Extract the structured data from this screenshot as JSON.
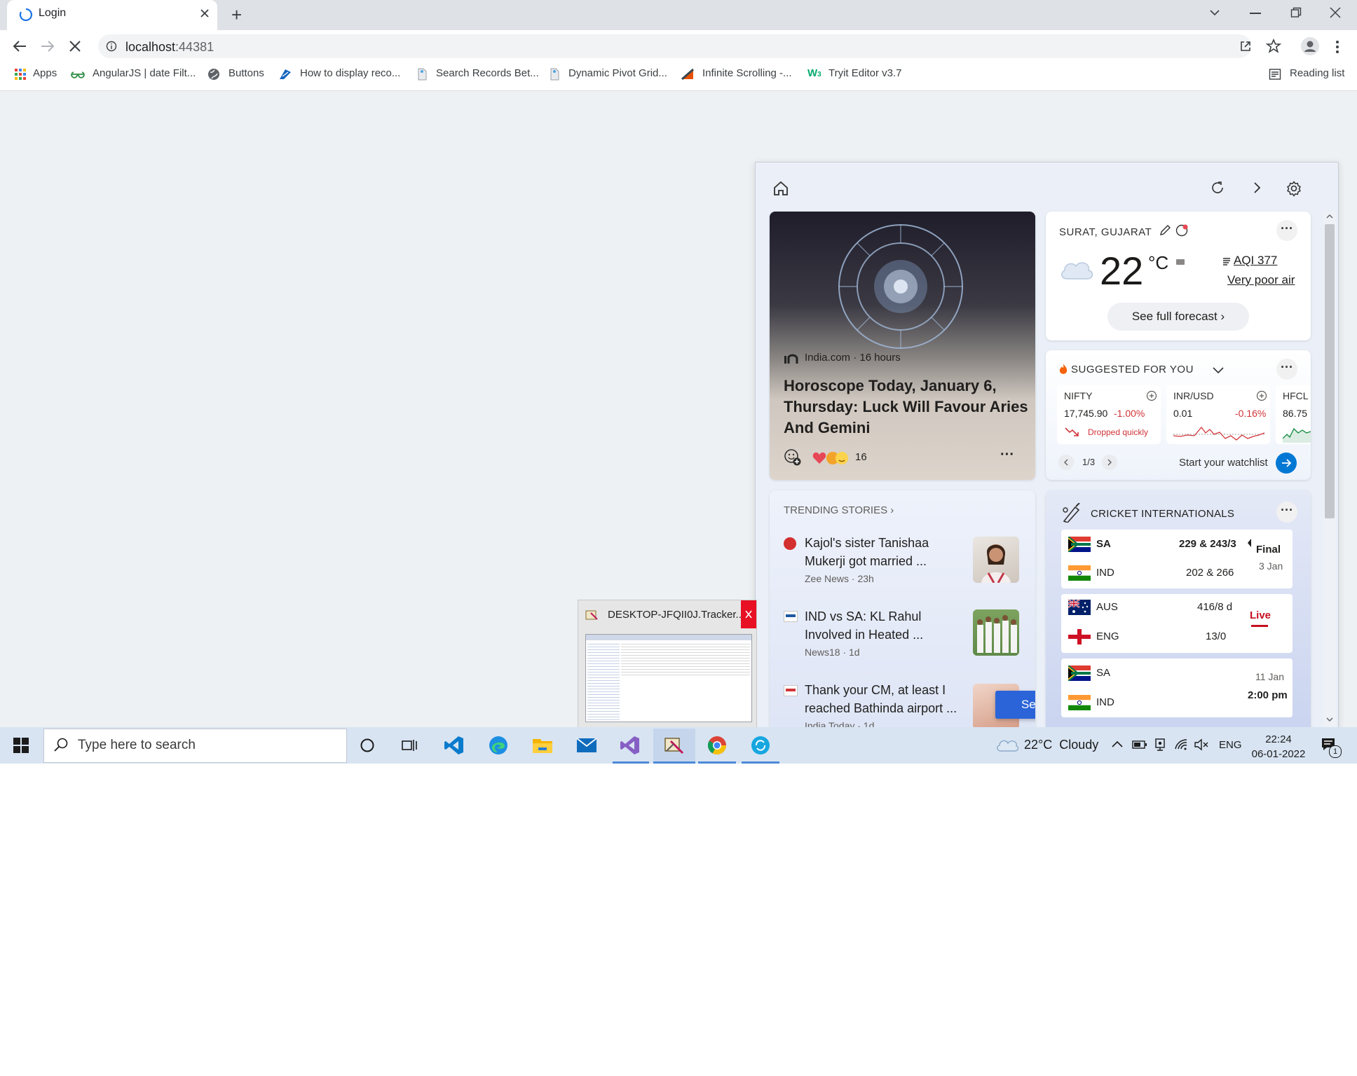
{
  "browser": {
    "tab_title": "Login",
    "new_tab": "+",
    "url_host": "localhost",
    "url_port": ":44381",
    "bookmarks": [
      {
        "label": "Apps",
        "icon": "apps-grid-icon"
      },
      {
        "label": "AngularJS | date Filt...",
        "icon": "geeks-icon"
      },
      {
        "label": "Buttons",
        "icon": "globe-icon"
      },
      {
        "label": "How to display reco...",
        "icon": "site-icon"
      },
      {
        "label": "Search Records Bet...",
        "icon": "page-icon"
      },
      {
        "label": "Dynamic Pivot Grid...",
        "icon": "page-icon"
      },
      {
        "label": "Infinite Scrolling -...",
        "icon": "site-icon"
      },
      {
        "label": "Tryit Editor v3.7",
        "icon": "w3-icon"
      }
    ],
    "reading_list": "Reading list"
  },
  "widgets": {
    "hero": {
      "source": "India.com · 16 hours",
      "title_line1": "Horoscope Today, January 6,",
      "title_line2": "Thursday: Luck Will Favour Aries",
      "title_line3": "And Gemini",
      "reactions": "16",
      "more": "···"
    },
    "weather": {
      "location": "SURAT, GUJARAT",
      "temp": "22",
      "unit": "°C",
      "aqi": "AQI 377",
      "air": "Very poor air",
      "forecast_btn": "See full forecast",
      "more": "···"
    },
    "finance": {
      "header": "SUGGESTED FOR YOU",
      "more": "···",
      "tickers": [
        {
          "name": "NIFTY",
          "price": "17,745.90",
          "change": "-1.00%",
          "note": "Dropped quickly"
        },
        {
          "name": "INR/USD",
          "price": "0.01",
          "change": "-0.16%"
        },
        {
          "name": "HFCL",
          "price": "86.75"
        }
      ],
      "page": "1/3",
      "watchlist": "Start your watchlist"
    },
    "trending": {
      "header": "TRENDING STORIES",
      "stories": [
        {
          "line1": "Kajol's sister Tanishaa",
          "line2": "Mukerji got married ...",
          "meta": "Zee News · 23h"
        },
        {
          "line1": "IND vs SA: KL Rahul",
          "line2": "Involved in Heated ...",
          "meta": "News18 · 1d"
        },
        {
          "line1": "Thank your CM, at least I",
          "line2": "reached Bathinda airport ...",
          "meta": "India Today · 1d"
        }
      ],
      "see_more": "See more"
    },
    "cricket": {
      "header": "CRICKET INTERNATIONALS",
      "more": "···",
      "matches": [
        {
          "team1": "SA",
          "score1": "229 & 243/3",
          "team2": "IND",
          "score2": "202 & 266",
          "status": "Final",
          "date": "3 Jan"
        },
        {
          "team1": "AUS",
          "score1": "416/8 d",
          "team2": "ENG",
          "score2": "13/0",
          "status": "Live"
        },
        {
          "team1": "SA",
          "team2": "IND",
          "date": "11 Jan",
          "time": "2:00 pm"
        }
      ]
    }
  },
  "thumbnail": {
    "title": "DESKTOP-JFQII0J.Tracker..."
  },
  "taskbar": {
    "search_placeholder": "Type here to search",
    "weather": "22°C  Cloudy",
    "lang": "ENG",
    "time": "22:24",
    "date": "06-01-2022",
    "notif_count": "1",
    "colors": {
      "accent": "#0078d4",
      "negative": "#d13438",
      "live": "#c50f1f"
    }
  }
}
